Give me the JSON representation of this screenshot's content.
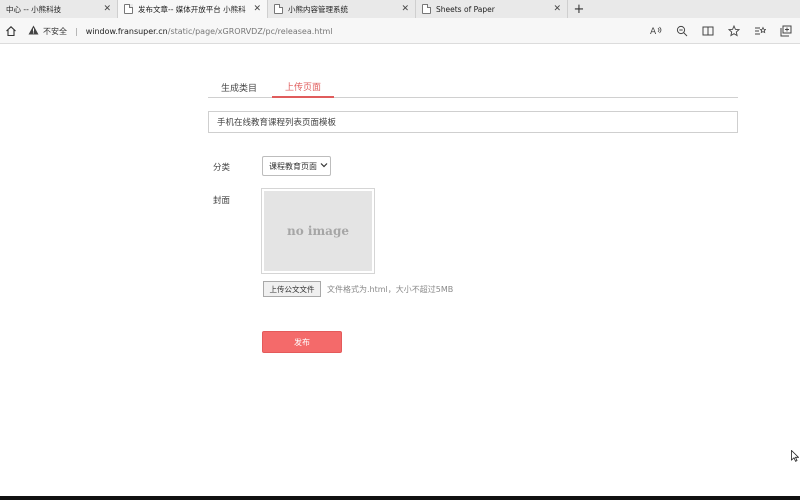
{
  "browser": {
    "tabs": [
      {
        "title": "中心 -- 小熊科技"
      },
      {
        "title": "发布文章-- 媒体开放平台 小熊科"
      },
      {
        "title": "小熊内容管理系统"
      },
      {
        "title": "Sheets of Paper"
      }
    ],
    "close_glyph": "✕",
    "new_tab_glyph": "+",
    "security_label": "不安全",
    "url_host": "window.fransuper.cn",
    "url_path": "/static/page/xGRORVDZ/pc/releasea.html"
  },
  "page": {
    "tabs": [
      {
        "label": "生成类目"
      },
      {
        "label": "上传页面"
      }
    ],
    "title_value": "手机在线教育课程列表页面模板",
    "category_label": "分类",
    "category_selected": "课程教育页面",
    "cover_label": "封面",
    "cover_placeholder": "no image",
    "upload_button": "上传公文文件",
    "upload_hint": "文件格式为.html，大小不超过5MB",
    "publish_button": "发布"
  },
  "colors": {
    "accent": "#e05c5c",
    "publish_bg": "#f46a6a"
  }
}
